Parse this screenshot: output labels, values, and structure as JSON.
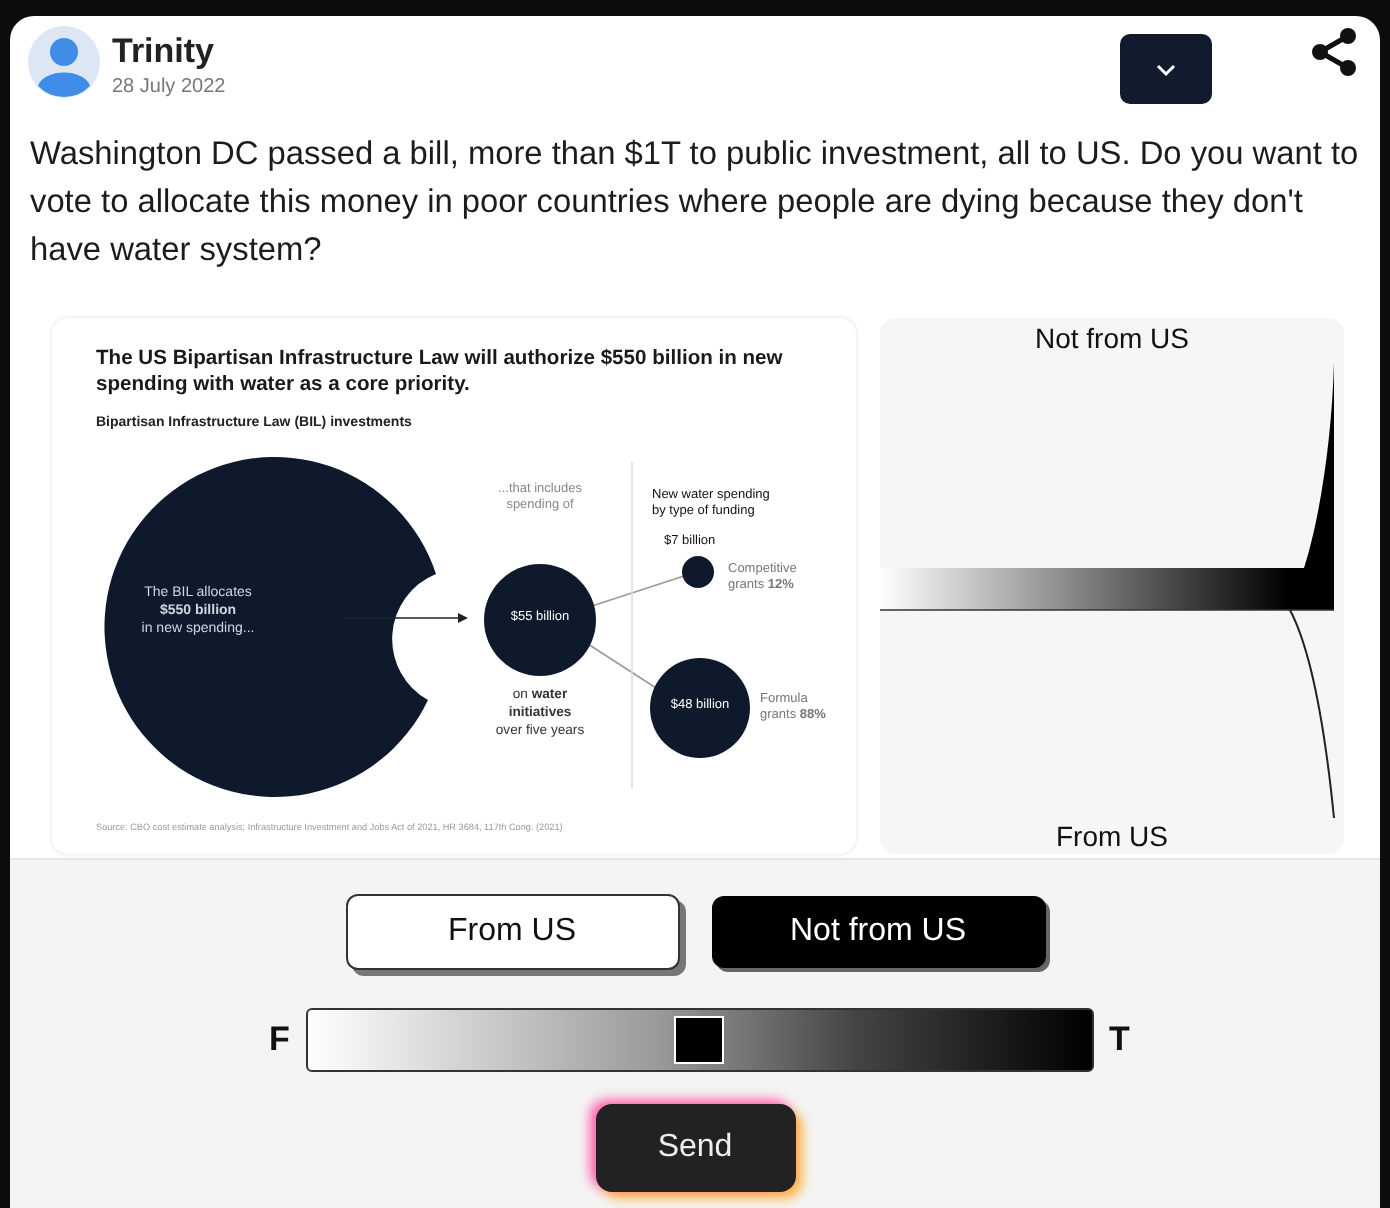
{
  "post": {
    "author": "Trinity",
    "date": "28 July 2022",
    "text": "Washington DC passed a bill, more than $1T to public investment, all to US. Do you want to vote to allocate this money in poor countries where people are dying because they don't have water system?"
  },
  "infographic": {
    "title": "The US Bipartisan Infrastructure Law will authorize $550 billion in new spending with water as a core priority.",
    "subtitle": "Bipartisan Infrastructure Law (BIL) investments",
    "labels": {
      "big": [
        "The BIL allocates",
        "**$550 billion**",
        "in new spending..."
      ],
      "includes": [
        "...that includes",
        "spending of"
      ],
      "mid": [
        "$55 billion"
      ],
      "water": [
        "on **water**",
        "**initiatives**",
        "over five years"
      ],
      "heading": [
        "New water spending",
        "by type of funding"
      ],
      "small_amount": [
        "$7 billion"
      ],
      "competitive": [
        "Competitive",
        "grants **12%**"
      ],
      "large": [
        "$48 billion"
      ],
      "formula": [
        "Formula",
        "grants **88%**"
      ]
    },
    "source": "Source: CBO cost estimate analysis; Infrastructure Investment and Jobs Act of 2021, HR 3684, 117th Cong. (2021)"
  },
  "gauge": {
    "top_label": "Not from US",
    "bottom_label": "From US"
  },
  "choices": [
    {
      "label": "From US",
      "selected": false
    },
    {
      "label": "Not from US",
      "selected": true
    }
  ],
  "slider": {
    "min_label": "F",
    "max_label": "T",
    "level": 0.5
  },
  "send": {
    "label": "Send"
  }
}
